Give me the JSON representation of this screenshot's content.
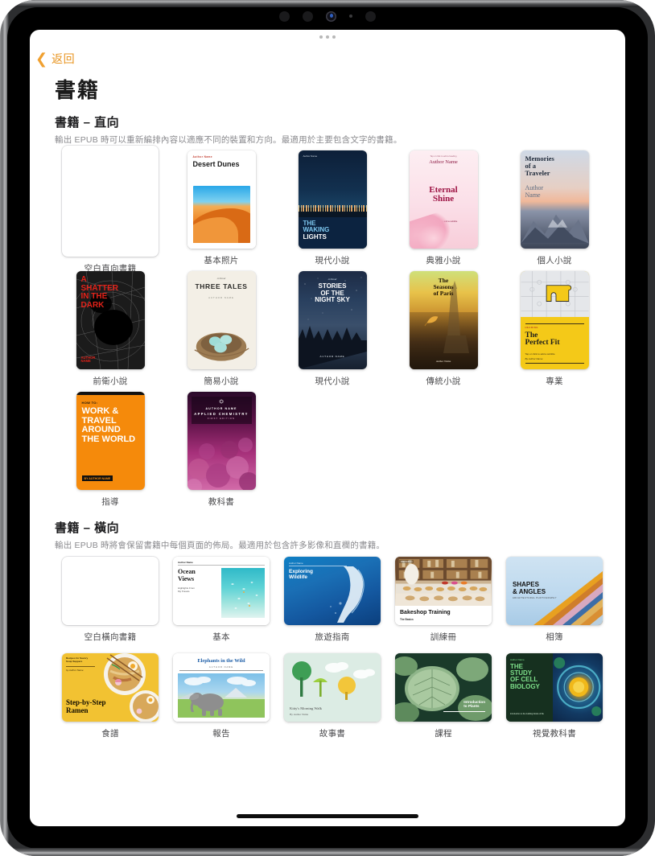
{
  "device": {
    "camera_icons": [
      "camera-lens",
      "camera-lens",
      "camera-lens-blue",
      "ambient-sensor-dot",
      "camera-lens"
    ]
  },
  "nav": {
    "back_label": "返回",
    "back_icon": "chevron-left-icon"
  },
  "page": {
    "title": "書籍"
  },
  "sections": [
    {
      "id": "portrait",
      "heading": "書籍 – 直向",
      "subheading": "輸出 EPUB 時可以重新編排內容以適應不同的裝置和方向。最適用於主要包含文字的書籍。",
      "orientation": "portrait",
      "items": [
        {
          "label": "空白直向書籍",
          "art": "blank",
          "title": "",
          "author": "",
          "subtitle": ""
        },
        {
          "label": "基本照片",
          "art": "desert-dunes",
          "title": "Desert Dunes",
          "author": "Author Name",
          "subtitle": ""
        },
        {
          "label": "現代小說",
          "art": "waking-lights",
          "title": "THE WAKING LIGHTS",
          "author": "Author Name",
          "subtitle": ""
        },
        {
          "label": "典雅小說",
          "art": "eternal-shine",
          "title": "Eternal Shine",
          "author": "Author Name",
          "subtitle": "Tap or click to add a subtitle",
          "kicker": "Tap or click to add a heading"
        },
        {
          "label": "個人小說",
          "art": "memories-traveler",
          "title": "Memories of a Traveler",
          "author": "Author Name",
          "subtitle": ""
        },
        {
          "label": "前衛小說",
          "art": "shatter-dark",
          "title": "A SHATTER IN THE DARK",
          "author": "AUTHOR NAME",
          "subtitle": ""
        },
        {
          "label": "簡易小說",
          "art": "three-tales",
          "title": "THREE TALES",
          "author": "AUTHOR NAME",
          "subtitle": "",
          "kicker": "A Novel"
        },
        {
          "label": "現代小說",
          "art": "night-sky",
          "title": "STORIES OF THE NIGHT SKY",
          "author": "AUTHOR NAME",
          "subtitle": "",
          "kicker": "A Novel"
        },
        {
          "label": "傳統小說",
          "art": "seasons-paris",
          "title": "The Seasons of Paris",
          "author": "Author Name",
          "subtitle": ""
        },
        {
          "label": "專業",
          "art": "perfect-fit",
          "title": "The Perfect Fit",
          "author": "By Author Name",
          "subtitle": "Tap or click to add a subtitle",
          "kicker": "HEADING"
        },
        {
          "label": "指導",
          "art": "work-travel",
          "title": "WORK & TRAVEL AROUND THE WORLD",
          "author": "BY AUTHOR NAME",
          "subtitle": "",
          "kicker": "HOW TO:"
        },
        {
          "label": "教科書",
          "art": "applied-chemistry",
          "title": "APPLIED CHEMISTRY",
          "author": "AUTHOR NAME",
          "subtitle": "FIRST EDITION",
          "kicker": ""
        }
      ]
    },
    {
      "id": "landscape",
      "heading": "書籍 – 橫向",
      "subheading": "輸出 EPUB 時將會保留書籍中每個頁面的佈局。最適用於包含許多影像和直欄的書籍。",
      "orientation": "landscape",
      "items": [
        {
          "label": "空白橫向書籍",
          "art": "blank",
          "title": "",
          "author": "",
          "subtitle": ""
        },
        {
          "label": "基本",
          "art": "ocean-views",
          "title": "Ocean Views",
          "author": "Author Name",
          "subtitle": "Highlights From My Travels"
        },
        {
          "label": "旅遊指南",
          "art": "exploring-wildlife",
          "title": "Exploring Wildlife",
          "author": "Author Name",
          "subtitle": ""
        },
        {
          "label": "訓練冊",
          "art": "bakeshop-training",
          "title": "Bakeshop Training",
          "author": "",
          "subtitle": "The Basics",
          "kicker": "2024 Edition"
        },
        {
          "label": "相簿",
          "art": "shapes-angles",
          "title": "SHAPES & ANGLES",
          "author": "",
          "subtitle": "ARCHITECTURAL PHOTOGRAPHY"
        },
        {
          "label": "食譜",
          "art": "ramen",
          "title": "Step-by-Step Ramen",
          "author": "by Author Name",
          "subtitle": "",
          "kicker": "Recipes for Savory Soup Suppers"
        },
        {
          "label": "報告",
          "art": "elephants",
          "title": "Elephants in the Wild",
          "author": "AUTHOR NAME",
          "subtitle": ""
        },
        {
          "label": "故事書",
          "art": "kitty-walk",
          "title": "Kitty's Morning Walk",
          "author": "By Author Name",
          "subtitle": ""
        },
        {
          "label": "課程",
          "art": "intro-plants",
          "title": "Introduction to Plants",
          "author": "",
          "subtitle": ""
        },
        {
          "label": "視覺教科書",
          "art": "cell-biology",
          "title": "THE STUDY OF CELL BIOLOGY",
          "author": "Author Name",
          "subtitle": "Introduction to the building blocks of life"
        }
      ]
    }
  ],
  "colors": {
    "accent": "#e8941f",
    "label": "#4a4a4c",
    "heading": "#1c1c1e",
    "subheading": "#8a8a8e",
    "screen_bg": "#ffffff"
  }
}
